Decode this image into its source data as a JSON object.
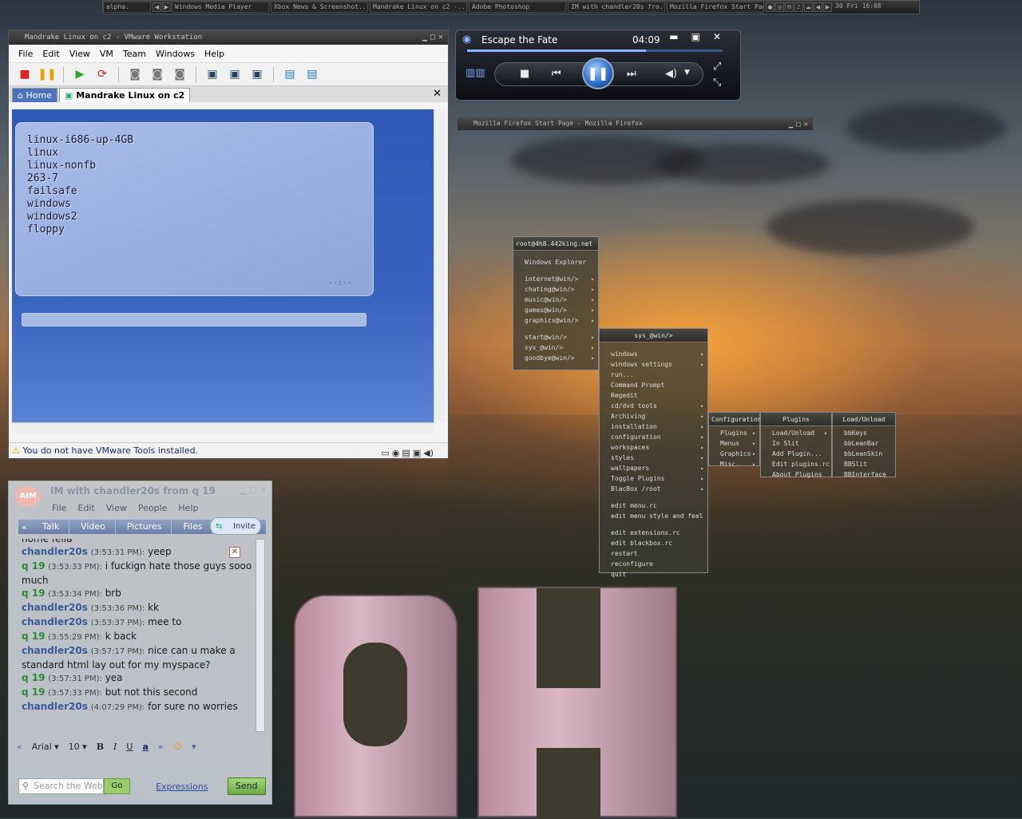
{
  "taskbar": {
    "items": [
      "alpha.",
      "Windows Media Player",
      "Xbox News & Screenshot...",
      "Mandrake Linux on c2 -...",
      "Adobe Photoshop",
      "IM with chandler20s fro...",
      "Mozilla Firefox Start Pag..."
    ],
    "clock": "30 Fri 16:08"
  },
  "vmware": {
    "title": "Mandrake Linux on c2 - VMware Workstation",
    "menu": [
      "File",
      "Edit",
      "View",
      "VM",
      "Team",
      "Windows",
      "Help"
    ],
    "tabs": [
      "Home",
      "Mandrake Linux on c2"
    ],
    "boot_entries": [
      "linux-i686-up-4GB",
      "linux",
      "linux-nonfb",
      "263-7",
      "failsafe",
      "windows",
      "windows2",
      "floppy"
    ],
    "boot_timer": "--:--",
    "status": "You do not have VMware Tools installed."
  },
  "wmp": {
    "track": "Escape the Fate",
    "time": "04:09",
    "seek_fraction": 0.7
  },
  "firefox": {
    "title": "Mozilla Firefox Start Page - Mozilla Firefox"
  },
  "bbmenu_root": {
    "title": "root@4h8.442king.net",
    "groups": [
      [
        "Windows Explorer"
      ],
      [
        "internet@win/>",
        "chating@win/>",
        "music@win/>",
        "games@win/>",
        "graphics@win/>"
      ],
      [
        "start@win/>",
        "sys_@win/>",
        "goodbye@win/>"
      ]
    ]
  },
  "bbmenu_sys": {
    "title": "sys_@win/>",
    "groups": [
      [
        "windows",
        "windows settings",
        "run...",
        "Command Prompt",
        "Regedit",
        "cd/dvd tools",
        "Archiving",
        "installation",
        "configuration",
        "workspaces",
        "styles",
        "wallpapers",
        "Toggle Plugins",
        "BlacBox /root"
      ],
      [
        "edit menu.rc",
        "edit menu style and feel"
      ],
      [
        "edit extensions.rc",
        "edit blackbox.rc",
        "restart",
        "reconfigure",
        "quit"
      ]
    ]
  },
  "bbmenu_config": {
    "title": "Configuration",
    "items": [
      "Plugins",
      "Menus",
      "Graphics",
      "Misc."
    ]
  },
  "bbmenu_plugins": {
    "title": "Plugins",
    "items": [
      "Load/Unload",
      "In Slit",
      "Add Plugin...",
      "Edit plugins.rc",
      "About Plugins"
    ]
  },
  "bbmenu_load": {
    "title": "Load/Unload",
    "items": [
      "bbKeys",
      "bbLeanBar",
      "bbLeanSkin",
      "BBSlit",
      "BBInterface"
    ]
  },
  "aim": {
    "title": "IM with chandler20s from q 19",
    "menu": [
      "File",
      "Edit",
      "View",
      "People",
      "Help"
    ],
    "tabs": [
      "Talk",
      "Video",
      "Pictures",
      "Files"
    ],
    "invite": "Invite",
    "log_top": "home fella",
    "messages": [
      {
        "who": "chandler20s",
        "ts": "(3:53:31 PM):",
        "text": "yeep"
      },
      {
        "who": "q 19",
        "ts": "(3:53:33 PM):",
        "text": "i fuckign hate those guys sooo much"
      },
      {
        "who": "q 19",
        "ts": "(3:53:34 PM):",
        "text": "brb"
      },
      {
        "who": "chandler20s",
        "ts": "(3:53:36 PM):",
        "text": "kk"
      },
      {
        "who": "chandler20s",
        "ts": "(3:53:37 PM):",
        "text": "mee to"
      },
      {
        "who": "q 19",
        "ts": "(3:55:29 PM):",
        "text": "k back"
      },
      {
        "who": "chandler20s",
        "ts": "(3:57:17 PM):",
        "text": "nice can u make a standard html lay out for my myspace?"
      },
      {
        "who": "q 19",
        "ts": "(3:57:31 PM):",
        "text": "yea"
      },
      {
        "who": "q 19",
        "ts": "(3:57:33 PM):",
        "text": "but not this second"
      },
      {
        "who": "chandler20s",
        "ts": "(4:07:29 PM):",
        "text": "for sure no worries"
      }
    ],
    "font": "Arial",
    "font_size": "10",
    "search_placeholder": "Search the Web",
    "go": "Go",
    "expressions": "Expressions",
    "send": "Send"
  }
}
